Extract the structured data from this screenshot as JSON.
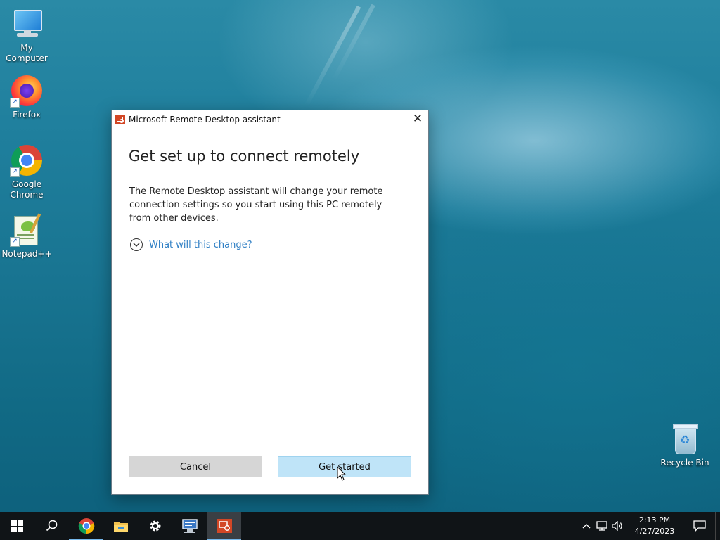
{
  "desktop": {
    "icons": [
      {
        "label": "My Computer"
      },
      {
        "label": "Firefox"
      },
      {
        "label": "Google Chrome"
      },
      {
        "label": "Notepad++"
      },
      {
        "label": "Recycle Bin"
      }
    ]
  },
  "dialog": {
    "title": "Microsoft Remote Desktop assistant",
    "close_glyph": "✕",
    "heading": "Get set up to connect remotely",
    "body": "The Remote Desktop assistant will change your remote connection settings so you start using this PC remotely from other devices.",
    "expander_label": "What will this change?",
    "cancel_label": "Cancel",
    "primary_label": "Get started"
  },
  "taskbar": {
    "pinned": [
      "start-icon",
      "search-icon",
      "chrome-icon",
      "file-explorer-icon",
      "settings-icon",
      "network-icon",
      "remote-desktop-assistant-icon"
    ],
    "active_app": "remote-desktop-assistant-icon",
    "clock": {
      "time": "2:13 PM",
      "date": "4/27/2023"
    }
  },
  "colors": {
    "accent": "#2f7fc4",
    "primary_button": "#bfe4f8",
    "taskbar": "#101417",
    "app_icon": "#d24726"
  }
}
